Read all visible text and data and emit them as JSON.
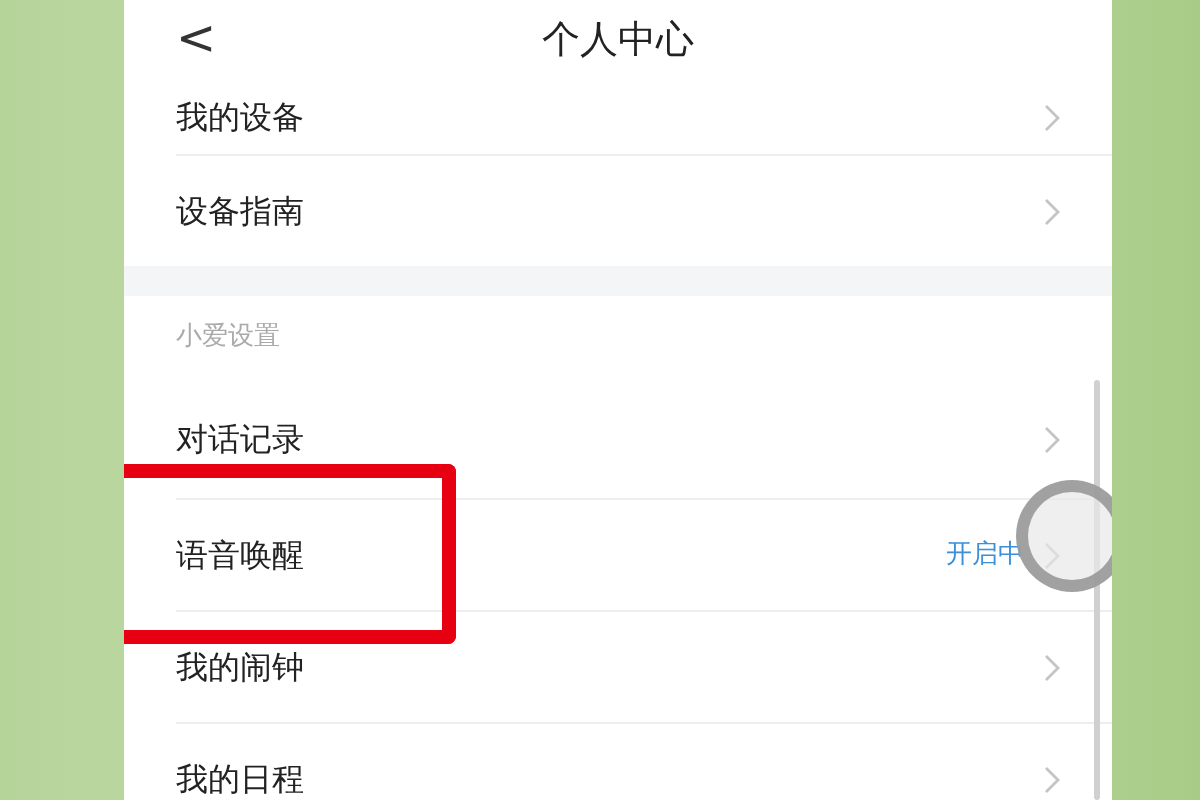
{
  "header": {
    "back": "<",
    "title": "个人中心"
  },
  "groups": [
    {
      "items": [
        {
          "label": "我的设备",
          "highlighted": false
        },
        {
          "label": "设备指南",
          "highlighted": false
        }
      ]
    },
    {
      "title": "小爱设置",
      "items": [
        {
          "label": "对话记录",
          "highlighted": false
        },
        {
          "label": "语音唤醒",
          "value": "开启中",
          "highlighted": true
        },
        {
          "label": "我的闹钟",
          "highlighted": false
        },
        {
          "label": "我的日程",
          "highlighted": false
        }
      ]
    }
  ]
}
